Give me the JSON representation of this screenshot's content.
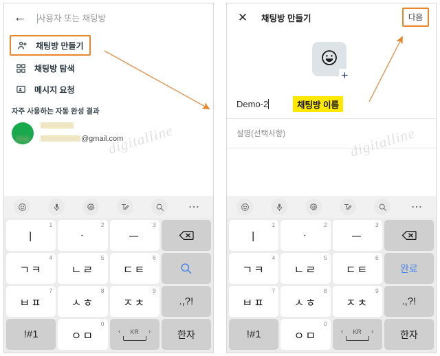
{
  "left_panel": {
    "appbar": {
      "back_icon": "back-arrow-icon",
      "search_placeholder": "사용자 또는 채팅방"
    },
    "menu_items": [
      {
        "icon": "person-add-icon",
        "label": "채팅방 만들기",
        "highlighted": true
      },
      {
        "icon": "grid-explore-icon",
        "label": "채팅방 탐색",
        "highlighted": false
      },
      {
        "icon": "message-request-icon",
        "label": "메시지 요청",
        "highlighted": false
      }
    ],
    "section_label": "자주 사용하는 자동 완성 결과",
    "contact": {
      "avatar_color": "#17a94b",
      "name_redacted": true,
      "email_tail": "@gmail.com"
    },
    "watermark": "digitalline"
  },
  "right_panel": {
    "appbar": {
      "close_icon": "close-x-icon",
      "title": "채팅방 만들기",
      "next_label": "다음"
    },
    "avatar_picker": {
      "icon": "smiley-face-icon",
      "add_glyph": "+"
    },
    "name_field": {
      "value": "Demo-2",
      "annotation": "채팅방 이름",
      "annotation_bg": "#ffe800"
    },
    "description_field": {
      "placeholder": "설명(선택사항)"
    },
    "watermark": "digitalline"
  },
  "keyboard": {
    "toolbar_icons": [
      "emoji-icon",
      "microphone-icon",
      "settings-gear-icon",
      "handwriting-icon",
      "search-icon",
      "more-options-icon"
    ],
    "rows_left": [
      [
        {
          "label": "ㅣ",
          "num": "1",
          "type": "char"
        },
        {
          "label": "·",
          "num": "2",
          "type": "char"
        },
        {
          "label": "ㅡ",
          "num": "3",
          "type": "char"
        },
        {
          "label": "backspace-icon",
          "num": "",
          "type": "fn-backspace"
        }
      ],
      [
        {
          "label": "ㄱㅋ",
          "num": "4",
          "type": "char"
        },
        {
          "label": "ㄴㄹ",
          "num": "5",
          "type": "char"
        },
        {
          "label": "ㄷㅌ",
          "num": "6",
          "type": "char"
        },
        {
          "label": "search-icon",
          "num": "",
          "type": "fn-search"
        }
      ],
      [
        {
          "label": "ㅂㅍ",
          "num": "7",
          "type": "char"
        },
        {
          "label": "ㅅㅎ",
          "num": "8",
          "type": "char"
        },
        {
          "label": "ㅈㅊ",
          "num": "9",
          "type": "char"
        },
        {
          "label": ".,?!",
          "num": "",
          "type": "fn-punct"
        }
      ],
      [
        {
          "label": "!#1",
          "num": "",
          "type": "fn-sym"
        },
        {
          "label": "ㅇㅁ",
          "num": "0",
          "type": "char"
        },
        {
          "label": "KR",
          "num": "",
          "type": "fn-space"
        },
        {
          "label": "한자",
          "num": "",
          "type": "fn-hanja"
        }
      ]
    ],
    "rows_right": [
      [
        {
          "label": "ㅣ",
          "num": "1",
          "type": "char"
        },
        {
          "label": "·",
          "num": "2",
          "type": "char"
        },
        {
          "label": "ㅡ",
          "num": "3",
          "type": "char"
        },
        {
          "label": "backspace-icon",
          "num": "",
          "type": "fn-backspace"
        }
      ],
      [
        {
          "label": "ㄱㅋ",
          "num": "4",
          "type": "char"
        },
        {
          "label": "ㄴㄹ",
          "num": "5",
          "type": "char"
        },
        {
          "label": "ㄷㅌ",
          "num": "6",
          "type": "char"
        },
        {
          "label": "완료",
          "num": "",
          "type": "fn-done"
        }
      ],
      [
        {
          "label": "ㅂㅍ",
          "num": "7",
          "type": "char"
        },
        {
          "label": "ㅅㅎ",
          "num": "8",
          "type": "char"
        },
        {
          "label": "ㅈㅊ",
          "num": "9",
          "type": "char"
        },
        {
          "label": ".,?!",
          "num": "",
          "type": "fn-punct"
        }
      ],
      [
        {
          "label": "!#1",
          "num": "",
          "type": "fn-sym"
        },
        {
          "label": "ㅇㅁ",
          "num": "0",
          "type": "char"
        },
        {
          "label": "KR",
          "num": "",
          "type": "fn-space"
        },
        {
          "label": "한자",
          "num": "",
          "type": "fn-hanja"
        }
      ]
    ]
  },
  "annotations": {
    "accent_color": "#e8862a",
    "arrow_1": "arrow-pointing-to-create-room-result",
    "arrow_2": "arrow-pointing-to-next-button"
  }
}
